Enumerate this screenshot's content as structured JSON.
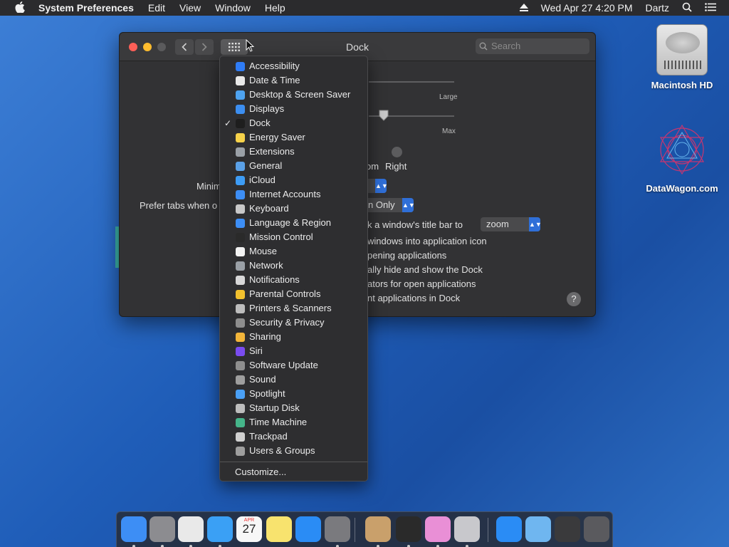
{
  "menubar": {
    "app": "System Preferences",
    "items": [
      "Edit",
      "View",
      "Window",
      "Help"
    ],
    "clock": "Wed Apr 27  4:20 PM",
    "user": "Dartz"
  },
  "desktop": {
    "icons": [
      {
        "label": "Macintosh HD"
      },
      {
        "label": "DataWagon.com"
      }
    ]
  },
  "window": {
    "title": "Dock",
    "search_placeholder": "Search",
    "pane": {
      "large_label": "Large",
      "max_label": "Max",
      "right_label": "Right",
      "left_partial": "om",
      "minimize_partial": "Minim",
      "prefer_tabs_partial": "Prefer tabs when o",
      "fullscreen_only_partial": "n Only",
      "double_click_partial": "k a window's title bar to",
      "zoom_value": "zoom",
      "opt1": "windows into application icon",
      "opt2": "pening applications",
      "opt3": "ally hide and show the Dock",
      "opt4": "ators for open applications",
      "opt5": "nt applications in Dock",
      "help": "?"
    }
  },
  "menu": {
    "checkmark": "✓",
    "items": [
      {
        "label": "Accessibility",
        "icon": "accessibility-icon",
        "color": "#2f7cf6"
      },
      {
        "label": "Date & Time",
        "icon": "clock-icon",
        "color": "#e9e9e9"
      },
      {
        "label": "Desktop & Screen Saver",
        "icon": "desktop-icon",
        "color": "#4ea3f0"
      },
      {
        "label": "Displays",
        "icon": "display-icon",
        "color": "#3c8ef0"
      },
      {
        "label": "Dock",
        "icon": "dock-icon",
        "color": "#1e1e1e",
        "checked": true
      },
      {
        "label": "Energy Saver",
        "icon": "lightbulb-icon",
        "color": "#f6d24a"
      },
      {
        "label": "Extensions",
        "icon": "puzzle-icon",
        "color": "#9aa0a6"
      },
      {
        "label": "General",
        "icon": "general-icon",
        "color": "#5aa0e6"
      },
      {
        "label": "iCloud",
        "icon": "cloud-icon",
        "color": "#3d9cf5"
      },
      {
        "label": "Internet Accounts",
        "icon": "at-icon",
        "color": "#3d8ef5"
      },
      {
        "label": "Keyboard",
        "icon": "keyboard-icon",
        "color": "#c8c8c8"
      },
      {
        "label": "Language & Region",
        "icon": "flag-icon",
        "color": "#3d8ef5"
      },
      {
        "label": "Mission Control",
        "icon": "mission-control-icon",
        "color": "#2a2a2a"
      },
      {
        "label": "Mouse",
        "icon": "mouse-icon",
        "color": "#f2f2f2"
      },
      {
        "label": "Network",
        "icon": "globe-icon",
        "color": "#9aa0a6"
      },
      {
        "label": "Notifications",
        "icon": "notifications-icon",
        "color": "#d8d8d8"
      },
      {
        "label": "Parental Controls",
        "icon": "parental-icon",
        "color": "#f2c12e"
      },
      {
        "label": "Printers & Scanners",
        "icon": "printer-icon",
        "color": "#bdbdbd"
      },
      {
        "label": "Security & Privacy",
        "icon": "lock-icon",
        "color": "#8e8e8e"
      },
      {
        "label": "Sharing",
        "icon": "sharing-icon",
        "color": "#f2b53a"
      },
      {
        "label": "Siri",
        "icon": "siri-icon",
        "color": "#7a4cf0"
      },
      {
        "label": "Software Update",
        "icon": "gear-icon",
        "color": "#8e8e8e"
      },
      {
        "label": "Sound",
        "icon": "speaker-icon",
        "color": "#9e9e9e"
      },
      {
        "label": "Spotlight",
        "icon": "search-icon",
        "color": "#4aa0f5"
      },
      {
        "label": "Startup Disk",
        "icon": "disk-icon",
        "color": "#bdbdbd"
      },
      {
        "label": "Time Machine",
        "icon": "time-machine-icon",
        "color": "#45b58a"
      },
      {
        "label": "Trackpad",
        "icon": "trackpad-icon",
        "color": "#d0d0d0"
      },
      {
        "label": "Users & Groups",
        "icon": "users-icon",
        "color": "#9e9e9e"
      }
    ],
    "customize": "Customize..."
  },
  "dock": {
    "apps": [
      {
        "name": "finder-icon",
        "color": "#3d8ef5",
        "running": true
      },
      {
        "name": "launchpad-icon",
        "color": "#8c8c90",
        "running": true
      },
      {
        "name": "chrome-icon",
        "color": "#e9e9e9",
        "running": true
      },
      {
        "name": "safari-icon",
        "color": "#3aa0f5",
        "running": true
      },
      {
        "name": "calendar-icon",
        "color": "#f7f7f7",
        "running": false,
        "text": "27",
        "subtext": "APR"
      },
      {
        "name": "notes-icon",
        "color": "#f8e36e",
        "running": false
      },
      {
        "name": "app-store-icon",
        "color": "#2a8cf5",
        "running": false
      },
      {
        "name": "system-preferences-icon",
        "color": "#7a7a7e",
        "running": true
      },
      {
        "name": "chess-icon",
        "color": "#c9a06b",
        "running": true
      },
      {
        "name": "piano-icon",
        "color": "#2a2a2a",
        "running": true
      },
      {
        "name": "grapher-icon",
        "color": "#e98fd6",
        "running": true
      },
      {
        "name": "automator-icon",
        "color": "#c8c8cc",
        "running": true
      },
      {
        "name": "app-store-folder-icon",
        "color": "#2a8cf5",
        "running": false
      },
      {
        "name": "folder-icon",
        "color": "#6fb6f0",
        "running": false
      },
      {
        "name": "downloads-stack-icon",
        "color": "#3a3a3c",
        "running": false
      },
      {
        "name": "trash-icon",
        "color": "#5a5a5e",
        "running": false
      }
    ]
  }
}
